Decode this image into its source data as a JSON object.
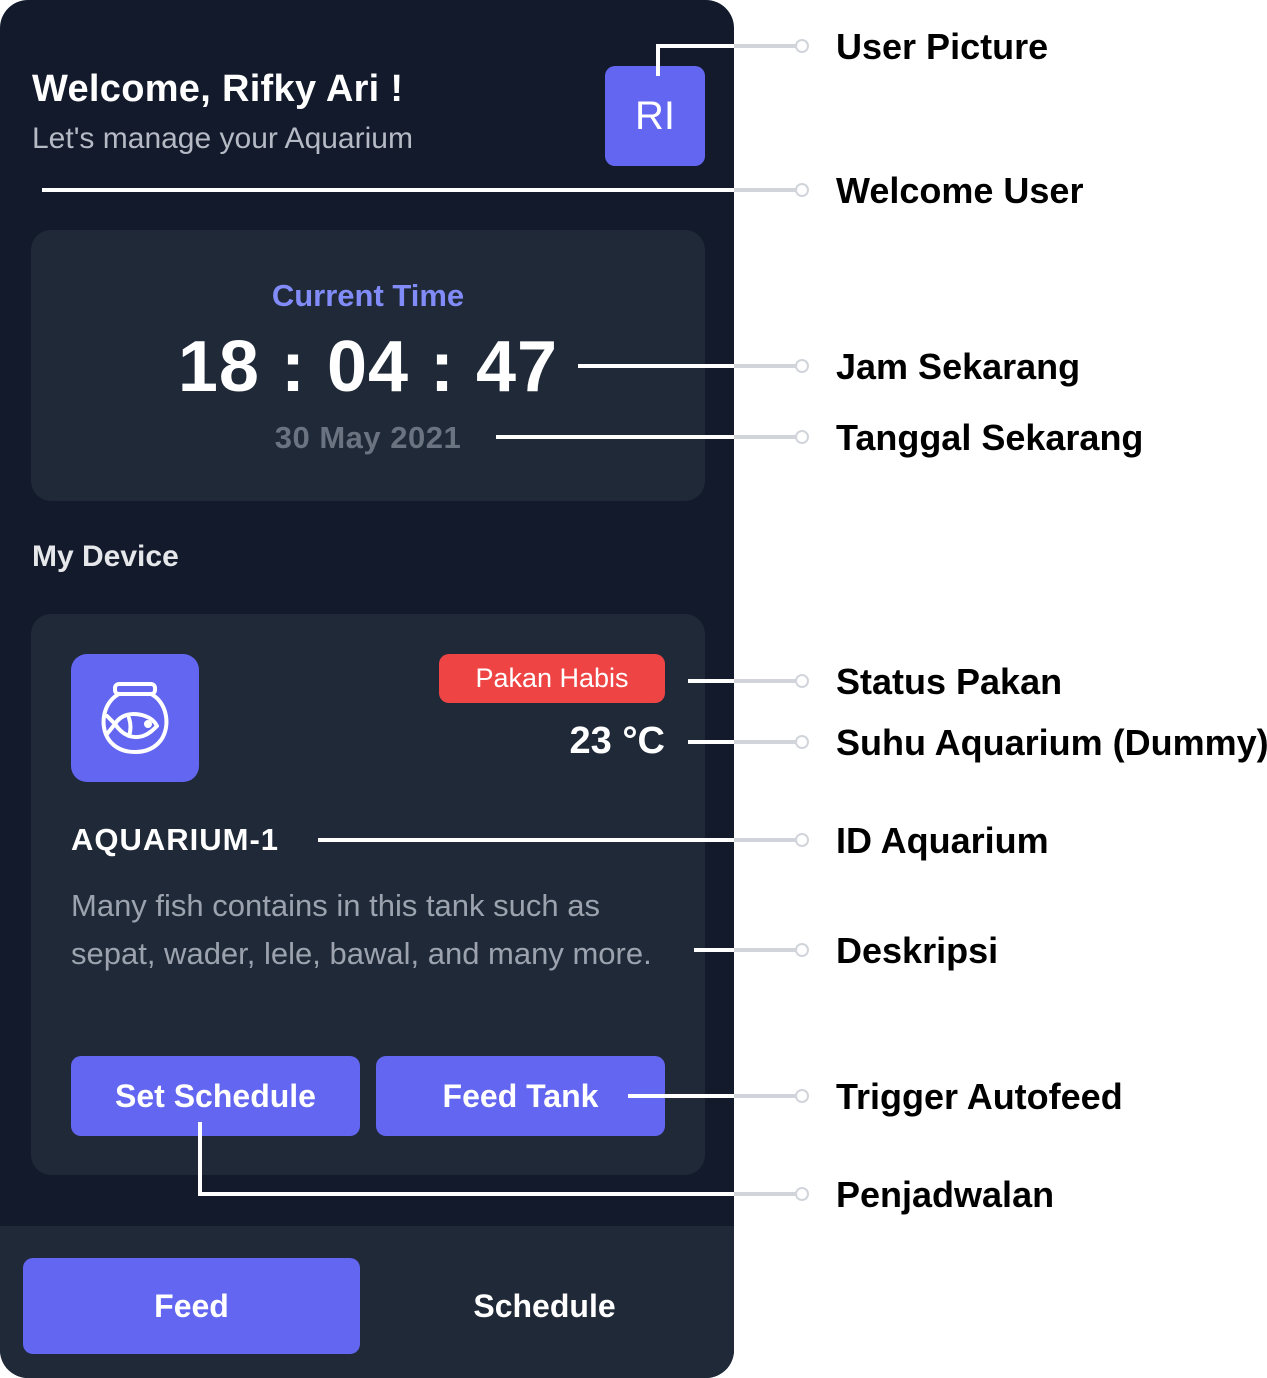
{
  "header": {
    "welcome_title": "Welcome, Rifky Ari !",
    "welcome_subtitle": "Let's manage your Aquarium",
    "avatar_initials": "RI"
  },
  "time_card": {
    "label": "Current Time",
    "time": "18 : 04 : 47",
    "date": "30 May 2021"
  },
  "section_title": "My Device",
  "device": {
    "icon": "fishbowl-icon",
    "status": "Pakan Habis",
    "temperature": "23 °C",
    "id": "AQUARIUM-1",
    "description": "Many fish contains in this tank such as sepat, wader, lele, bawal, and many more.",
    "set_schedule_label": "Set Schedule",
    "feed_tank_label": "Feed Tank"
  },
  "bottom_nav": {
    "feed_label": "Feed",
    "schedule_label": "Schedule"
  },
  "annotations": {
    "user_picture": "User Picture",
    "welcome_user": "Welcome User",
    "jam_sekarang": "Jam Sekarang",
    "tanggal_sekarang": "Tanggal Sekarang",
    "status_pakan": "Status Pakan",
    "suhu_aquarium": "Suhu Aquarium (Dummy)",
    "id_aquarium": "ID Aquarium",
    "deskripsi": "Deskripsi",
    "trigger_autofeed": "Trigger Autofeed",
    "penjadwalan": "Penjadwalan"
  },
  "colors": {
    "background": "#121a2b",
    "card": "#1f2937",
    "accent": "#6366f1",
    "accent_text": "#818cf8",
    "danger": "#ef4444"
  }
}
